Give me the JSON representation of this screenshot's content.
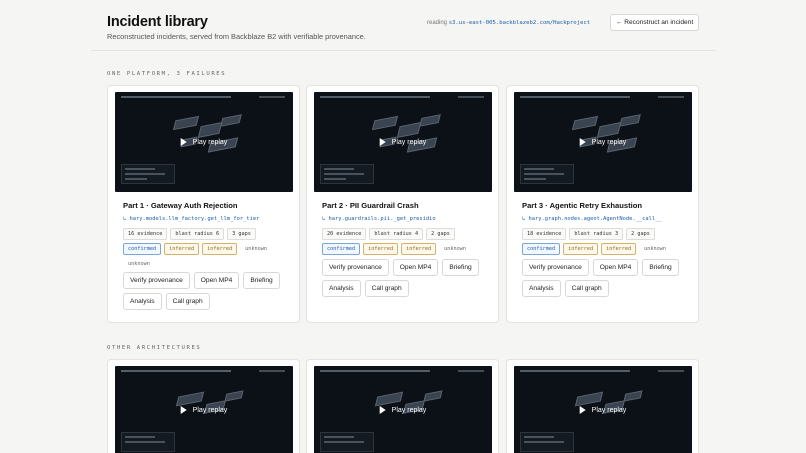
{
  "header": {
    "title": "Incident library",
    "subtitle": "Reconstructed incidents, served from Backblaze B2 with verifiable provenance.",
    "reading_label": "reading",
    "reading_path": "s3.us-east-005.backblazeb2.com/Hackproject",
    "reconstruct_button": "← Reconstruct an incident"
  },
  "sections": {
    "one_platform": "ONE PLATFORM, 3 FAILURES",
    "other_architectures": "OTHER ARCHITECTURES"
  },
  "play_label": "Play replay",
  "cards": [
    {
      "title": "Part 1 · Gateway Auth Rejection",
      "path": "↳ hary.models.llm_factory.get_llm_for_tier",
      "evidence": "16 evidence",
      "blast": "blast radius 6",
      "gaps": "3 gaps",
      "tags": [
        "confirmed",
        "inferred",
        "inferred",
        "unknown",
        "unknown"
      ],
      "buttons": [
        "Verify provenance",
        "Open MP4",
        "Briefing",
        "Analysis",
        "Call graph"
      ]
    },
    {
      "title": "Part 2 · PII Guardrail Crash",
      "path": "↳ hary.guardrails.pii._get_presidio",
      "evidence": "20 evidence",
      "blast": "blast radius 4",
      "gaps": "2 gaps",
      "tags": [
        "confirmed",
        "inferred",
        "inferred",
        "unknown"
      ],
      "buttons": [
        "Verify provenance",
        "Open MP4",
        "Briefing",
        "Analysis",
        "Call graph"
      ]
    },
    {
      "title": "Part 3 · Agentic Retry Exhaustion",
      "path": "↳ hary.graph.nodes.agent.AgentNode.__call__",
      "evidence": "18 evidence",
      "blast": "blast radius 3",
      "gaps": "2 gaps",
      "tags": [
        "confirmed",
        "inferred",
        "inferred",
        "unknown"
      ],
      "buttons": [
        "Verify provenance",
        "Open MP4",
        "Briefing",
        "Analysis",
        "Call graph"
      ]
    }
  ],
  "colors": {
    "accent_blue": "#1b5eae",
    "inferred_amber": "#9b6b10",
    "thumbnail_bg": "#0c1117"
  }
}
